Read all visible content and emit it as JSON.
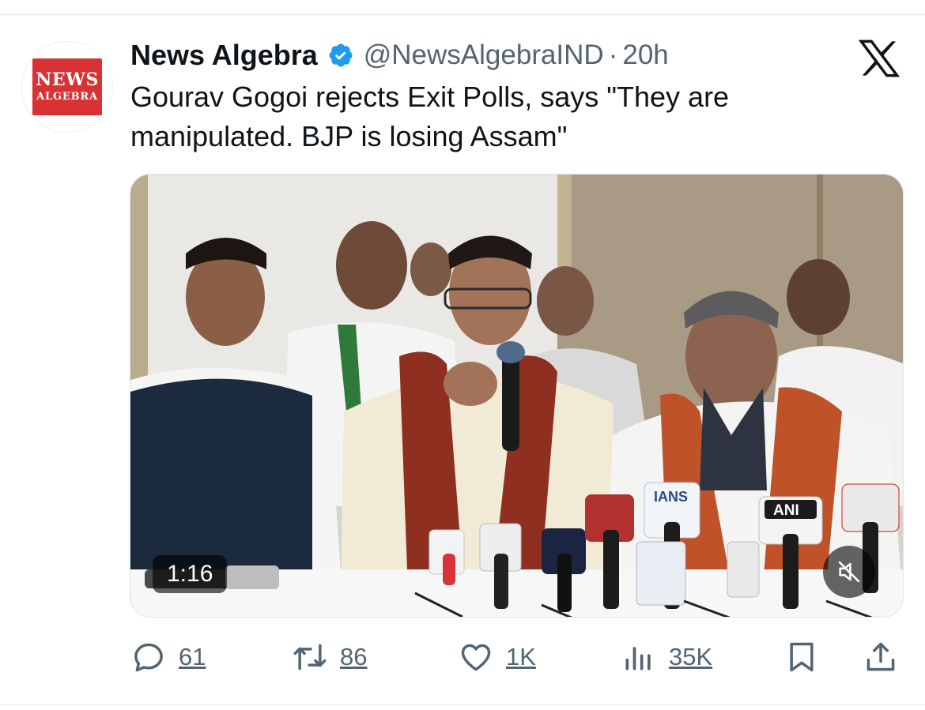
{
  "account": {
    "name": "News Algebra",
    "handle": "@NewsAlgebraIND",
    "separator": "·",
    "time": "20h",
    "logo_line1": "NEWS",
    "logo_line2": "ALGEBRA"
  },
  "tweet": {
    "text_line1": "Gourav Gogoi rejects Exit Polls, says \"They are",
    "text_line2": "manipulated. BJP is losing Assam\""
  },
  "media": {
    "duration": "1:16",
    "mic_labels": [
      "IANS",
      "ANI"
    ]
  },
  "actions": {
    "replies": "61",
    "reposts": "86",
    "likes": "1K",
    "views": "35K"
  },
  "colors": {
    "verified": "#1d9bf0",
    "secondary_text": "#536471",
    "logo_red": "#d93234"
  },
  "icons": [
    "verified-badge-icon",
    "x-logo-icon",
    "mute-icon",
    "reply-icon",
    "repost-icon",
    "like-icon",
    "views-icon",
    "bookmark-icon",
    "share-icon"
  ]
}
